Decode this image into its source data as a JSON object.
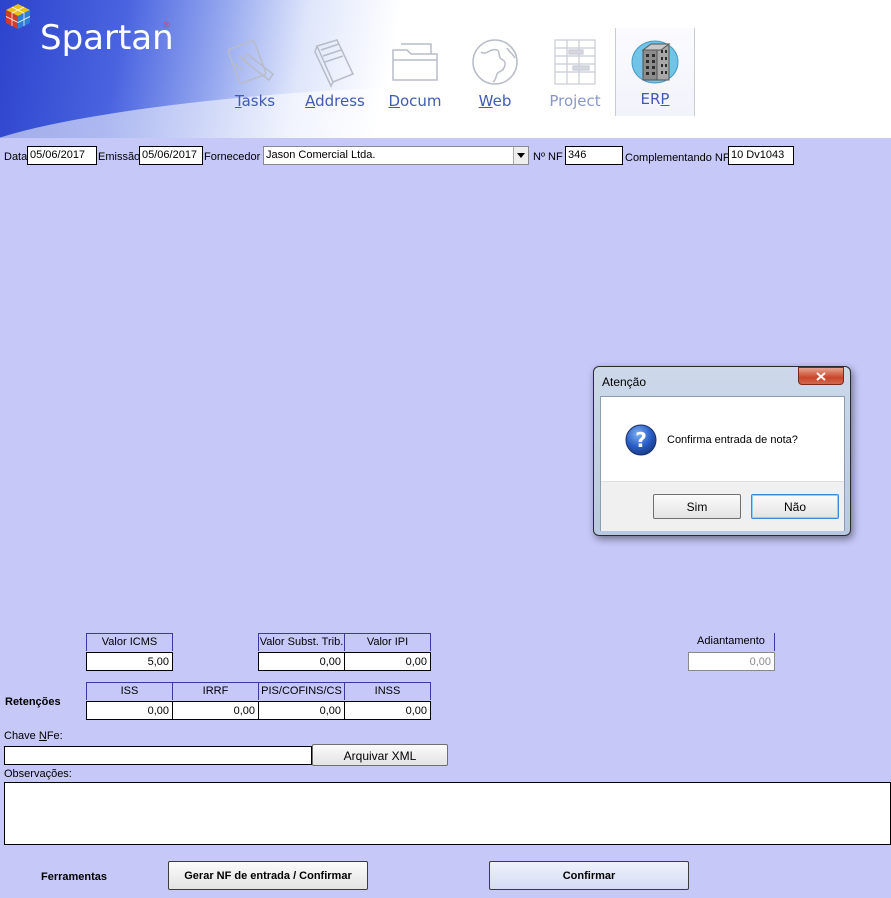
{
  "header": {
    "app_title": "Spartan",
    "reg_mark": "®",
    "nav": [
      {
        "key": "tasks",
        "mnemonic": "T",
        "rest": "asks",
        "icon": "tasks-icon"
      },
      {
        "key": "address",
        "mnemonic": "A",
        "rest": "ddress",
        "icon": "address-book-icon"
      },
      {
        "key": "docum",
        "mnemonic": "D",
        "rest": "ocum",
        "icon": "folder-icon"
      },
      {
        "key": "web",
        "mnemonic": "W",
        "rest": "eb",
        "icon": "globe-icon"
      },
      {
        "key": "project",
        "mnemonic": "",
        "rest": "Project",
        "icon": "gantt-icon"
      },
      {
        "key": "erp",
        "pre": "ER",
        "mnemonic": "P",
        "icon": "building-icon"
      }
    ]
  },
  "form": {
    "data_label": "Data",
    "data_value": "05/06/2017",
    "emissao_label": "Emissão",
    "emissao_value": "05/06/2017",
    "fornecedor_label": "Fornecedor",
    "fornecedor_value": "Jason Comercial Ltda.",
    "nf_label": "Nº NF",
    "nf_value": "346",
    "complementando_label": "Complementando NF:",
    "complementando_value": "10 Dv1043"
  },
  "totals": {
    "valor_icms_label": "Valor ICMS",
    "valor_icms": "5,00",
    "valor_subst_label": "Valor Subst. Trib.",
    "valor_subst": "0,00",
    "valor_ipi_label": "Valor IPI",
    "valor_ipi": "0,00",
    "adiantamento_label": "Adiantamento",
    "adiantamento": "0,00"
  },
  "retencoes": {
    "label": "Retenções",
    "iss_label": "ISS",
    "iss": "0,00",
    "irrf_label": "IRRF",
    "irrf": "0,00",
    "pis_label": "PIS/COFINS/CS",
    "pis": "0,00",
    "inss_label": "INSS",
    "inss": "0,00"
  },
  "chave": {
    "label_pre": "Chave ",
    "label_mnemonic": "N",
    "label_post": "Fe:",
    "value": "",
    "arquivar_label": "Arquivar XML"
  },
  "observacoes": {
    "label": "Observações:",
    "value": ""
  },
  "footer": {
    "ferramentas_label": "Ferramentas",
    "gerar_label": "Gerar NF de entrada / Confirmar",
    "confirmar_label": "Confirmar"
  },
  "dialog": {
    "title": "Atenção",
    "message": "Confirma entrada de nota?",
    "yes_label": "Sim",
    "no_label": "Não",
    "icon": "question-icon"
  }
}
